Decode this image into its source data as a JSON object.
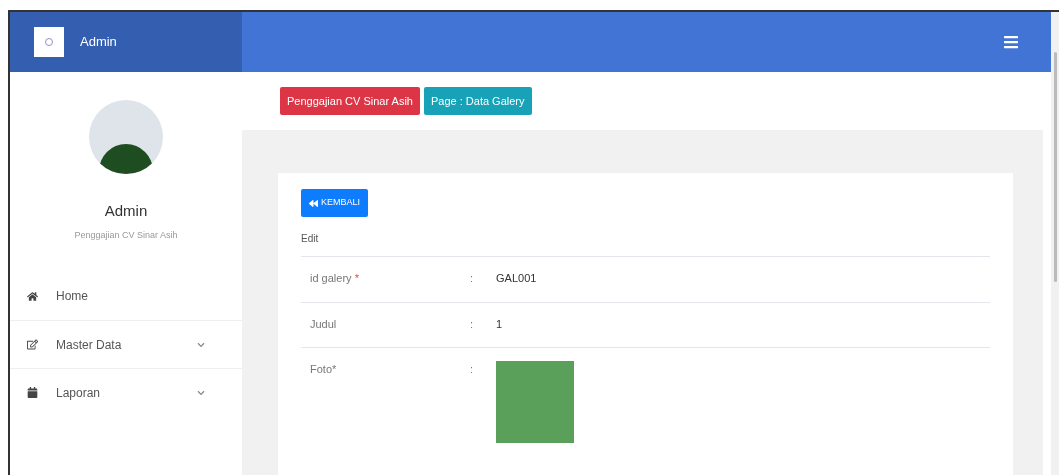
{
  "header": {
    "brand": "Admin"
  },
  "sidebar": {
    "user_name": "Admin",
    "user_subtitle": "Penggajian CV Sinar Asih",
    "items": [
      {
        "label": "Home",
        "kind": "link"
      },
      {
        "label": "Master Data",
        "kind": "dropdown"
      },
      {
        "label": "Laporan",
        "kind": "dropdown"
      }
    ]
  },
  "breadcrumbs": [
    {
      "label": "Penggajian CV Sinar Asih",
      "kind": "app"
    },
    {
      "label": "Page : Data Galery",
      "kind": "page"
    }
  ],
  "card": {
    "back_button": "KEMBALI",
    "section_title": "Edit",
    "fields": [
      {
        "label": "id galery",
        "required_mark": "*",
        "separator": ":",
        "value": "GAL001",
        "kind": "text"
      },
      {
        "label": "Judul",
        "separator": ":",
        "value": "1",
        "kind": "text"
      },
      {
        "label": "Foto*",
        "separator": ":",
        "kind": "image"
      }
    ]
  }
}
